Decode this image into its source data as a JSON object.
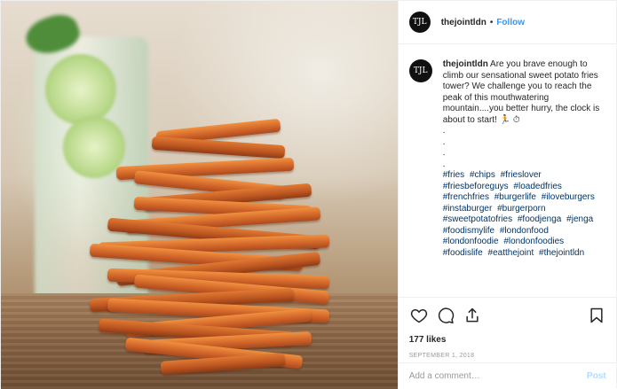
{
  "header": {
    "avatar_text": "TJL",
    "username": "thejointldn",
    "separator": "•",
    "follow_label": "Follow"
  },
  "caption": {
    "avatar_text": "TJL",
    "username": "thejointldn",
    "text": "Are you brave enough to climb our sensational sweet potato fries tower? We challenge you to reach the peak of this mouthwatering mountain....you better hurry, the clock is about to start! 🏃 ⏱",
    "dots": [
      ".",
      ".",
      ".",
      "."
    ],
    "hashtags": [
      "#fries",
      "#chips",
      "#frieslover",
      "#friesbeforeguys",
      "#loadedfries",
      "#frenchfries",
      "#burgerlife",
      "#iloveburgers",
      "#instaburger",
      "#burgerporn",
      "#sweetpotatofries",
      "#foodjenga",
      "#jenga",
      "#foodismylife",
      "#londonfood",
      "#londonfoodie",
      "#londonfoodies",
      "#foodislife",
      "#eatthejoint",
      "#thejointldn"
    ]
  },
  "actions": {
    "icons": [
      "heart-icon",
      "comment-icon",
      "share-icon",
      "bookmark-icon"
    ],
    "likes": "177 likes",
    "date": "September 1, 2018"
  },
  "comment": {
    "placeholder": "Add a comment…",
    "post_label": "Post"
  },
  "colors": {
    "link": "#3897f0",
    "hashtag": "#003569",
    "post_disabled": "#b3dbff",
    "border": "#efefef"
  }
}
